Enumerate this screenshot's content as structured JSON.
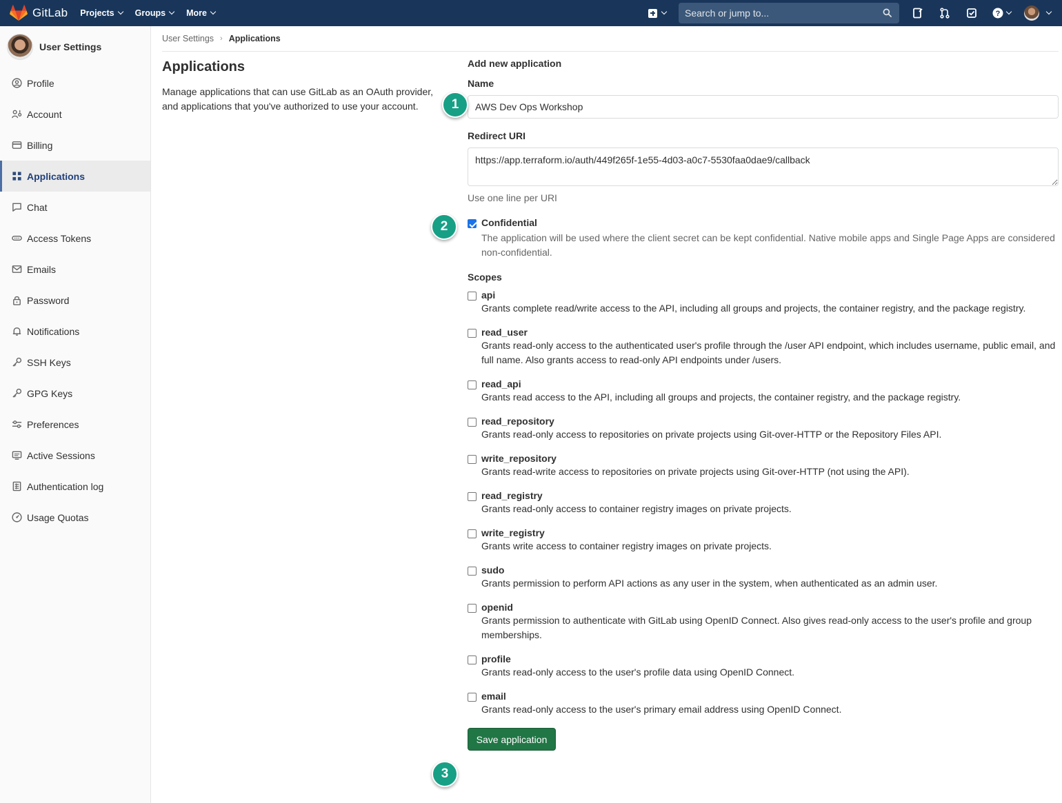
{
  "navbar": {
    "brand": "GitLab",
    "menu": [
      {
        "label": "Projects"
      },
      {
        "label": "Groups"
      },
      {
        "label": "More"
      }
    ],
    "search_placeholder": "Search or jump to..."
  },
  "sidebar": {
    "title": "User Settings",
    "items": [
      {
        "label": "Profile",
        "icon": "profile-icon"
      },
      {
        "label": "Account",
        "icon": "account-icon"
      },
      {
        "label": "Billing",
        "icon": "billing-icon"
      },
      {
        "label": "Applications",
        "icon": "applications-icon",
        "active": true
      },
      {
        "label": "Chat",
        "icon": "chat-icon"
      },
      {
        "label": "Access Tokens",
        "icon": "token-icon"
      },
      {
        "label": "Emails",
        "icon": "mail-icon"
      },
      {
        "label": "Password",
        "icon": "lock-icon"
      },
      {
        "label": "Notifications",
        "icon": "bell-icon"
      },
      {
        "label": "SSH Keys",
        "icon": "key-icon"
      },
      {
        "label": "GPG Keys",
        "icon": "key-icon"
      },
      {
        "label": "Preferences",
        "icon": "preferences-icon"
      },
      {
        "label": "Active Sessions",
        "icon": "monitor-icon"
      },
      {
        "label": "Authentication log",
        "icon": "log-icon"
      },
      {
        "label": "Usage Quotas",
        "icon": "quota-icon"
      }
    ]
  },
  "breadcrumb": {
    "parent": "User Settings",
    "current": "Applications"
  },
  "intro": {
    "title": "Applications",
    "description": "Manage applications that can use GitLab as an OAuth provider, and applications that you've authorized to use your account."
  },
  "form": {
    "section_title": "Add new application",
    "name_label": "Name",
    "name_value": "AWS Dev Ops Workshop",
    "redirect_label": "Redirect URI",
    "redirect_value": "https://app.terraform.io/auth/449f265f-1e55-4d03-a0c7-5530faa0dae9/callback",
    "redirect_help": "Use one line per URI",
    "confidential_label": "Confidential",
    "confidential_checked": true,
    "confidential_help": "The application will be used where the client secret can be kept confidential. Native mobile apps and Single Page Apps are considered non-confidential.",
    "scopes_label": "Scopes",
    "scopes": [
      {
        "name": "api",
        "desc": "Grants complete read/write access to the API, including all groups and projects, the container registry, and the package registry."
      },
      {
        "name": "read_user",
        "desc": "Grants read-only access to the authenticated user's profile through the /user API endpoint, which includes username, public email, and full name. Also grants access to read-only API endpoints under /users."
      },
      {
        "name": "read_api",
        "desc": "Grants read access to the API, including all groups and projects, the container registry, and the package registry."
      },
      {
        "name": "read_repository",
        "desc": "Grants read-only access to repositories on private projects using Git-over-HTTP or the Repository Files API."
      },
      {
        "name": "write_repository",
        "desc": "Grants read-write access to repositories on private projects using Git-over-HTTP (not using the API)."
      },
      {
        "name": "read_registry",
        "desc": "Grants read-only access to container registry images on private projects."
      },
      {
        "name": "write_registry",
        "desc": "Grants write access to container registry images on private projects."
      },
      {
        "name": "sudo",
        "desc": "Grants permission to perform API actions as any user in the system, when authenticated as an admin user."
      },
      {
        "name": "openid",
        "desc": "Grants permission to authenticate with GitLab using OpenID Connect. Also gives read-only access to the user's profile and group memberships."
      },
      {
        "name": "profile",
        "desc": "Grants read-only access to the user's profile data using OpenID Connect."
      },
      {
        "name": "email",
        "desc": "Grants read-only access to the user's primary email address using OpenID Connect."
      }
    ],
    "save_label": "Save application"
  },
  "markers": [
    "1",
    "2",
    "3"
  ],
  "colors": {
    "navbar": "#19365a",
    "save_button": "#217645",
    "marker": "#17a085",
    "active_sidebar": "#ebebeb"
  }
}
